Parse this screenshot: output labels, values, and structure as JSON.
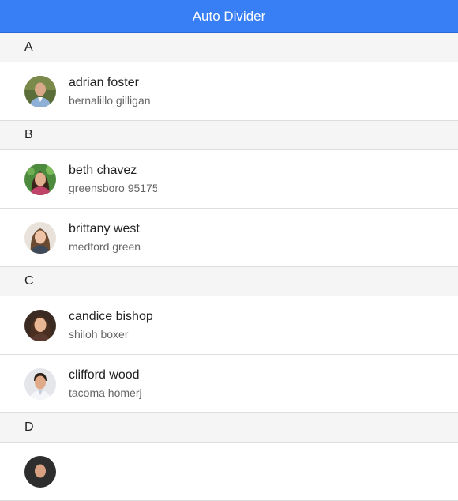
{
  "header": {
    "title": "Auto Divider"
  },
  "dividers": [
    "A",
    "B",
    "C",
    "D"
  ],
  "contacts": [
    {
      "name": "adrian foster",
      "sub": "bernalillo gilligan"
    },
    {
      "name": "beth chavez",
      "sub": "greensboro 95175"
    },
    {
      "name": "brittany west",
      "sub": "medford green"
    },
    {
      "name": "candice bishop",
      "sub": "shiloh boxer"
    },
    {
      "name": "clifford wood",
      "sub": "tacoma homerj"
    }
  ],
  "colors": {
    "header": "#387ef5",
    "divider_bg": "#f5f5f5",
    "border": "#dddddd"
  }
}
